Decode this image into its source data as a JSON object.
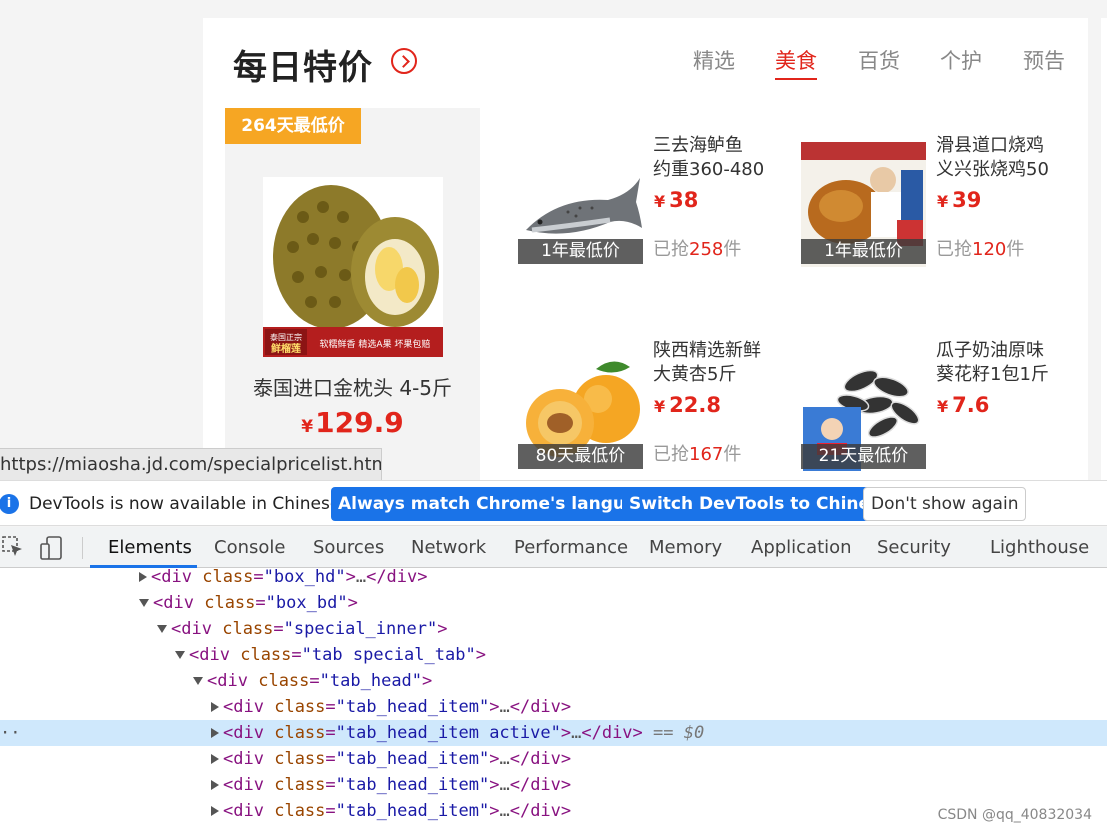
{
  "page": {
    "title": "每日特价",
    "tabs": [
      "精选",
      "美食",
      "百货",
      "个护",
      "预告"
    ],
    "active_tab": 1,
    "featured": {
      "tag": "264天最低价",
      "name": "泰国进口金枕头 4-5斤",
      "price_currency": "¥",
      "price": "129.9",
      "banner_text": [
        "泰国正宗",
        "鲜榴莲",
        "软糯鲜香",
        "精选A果",
        "坏果包赔"
      ]
    },
    "products": [
      {
        "name_line1": "三去海鲈鱼",
        "name_line2": "约重360-480",
        "currency": "¥",
        "price": "38",
        "badge": "1年最低价",
        "sold_prefix": "已抢",
        "sold_count": "258",
        "sold_suffix": "件"
      },
      {
        "name_line1": "滑县道口烧鸡",
        "name_line2": "义兴张烧鸡50",
        "currency": "¥",
        "price": "39",
        "badge": "1年最低价",
        "sold_prefix": "已抢",
        "sold_count": "120",
        "sold_suffix": "件"
      },
      {
        "name_line1": "陕西精选新鲜",
        "name_line2": "大黄杏5斤",
        "currency": "¥",
        "price": "22.8",
        "badge": "80天最低价",
        "sold_prefix": "已抢",
        "sold_count": "167",
        "sold_suffix": "件"
      },
      {
        "name_line1": "瓜子奶油原味",
        "name_line2": "葵花籽1包1斤",
        "currency": "¥",
        "price": "7.6",
        "badge": "21天最低价",
        "sold_prefix": "",
        "sold_count": "",
        "sold_suffix": ""
      }
    ]
  },
  "status_url": "https://miaosha.jd.com/specialpricelist.html",
  "devtools": {
    "infobar": {
      "message": "DevTools is now available in Chinese!",
      "btn_match": "Always match Chrome's language",
      "btn_switch": "Switch DevTools to Chinese",
      "btn_dismiss": "Don't show again"
    },
    "tabs": [
      "Elements",
      "Console",
      "Sources",
      "Network",
      "Performance",
      "Memory",
      "Application",
      "Security",
      "Lighthouse"
    ],
    "active_tab": "Elements",
    "dom_lines": [
      {
        "tag": "div",
        "attr": "class",
        "value": "box_hd",
        "collapsed": true,
        "close": true
      },
      {
        "tag": "div",
        "attr": "class",
        "value": "box_bd",
        "collapsed": false,
        "close": false
      },
      {
        "tag": "div",
        "attr": "class",
        "value": "special_inner",
        "collapsed": false,
        "close": false
      },
      {
        "tag": "div",
        "attr": "class",
        "value": "tab special_tab",
        "collapsed": false,
        "close": false
      },
      {
        "tag": "div",
        "attr": "class",
        "value": "tab_head",
        "collapsed": false,
        "close": false
      },
      {
        "tag": "div",
        "attr": "class",
        "value": "tab_head_item",
        "collapsed": true,
        "close": true
      },
      {
        "tag": "div",
        "attr": "class",
        "value": "tab_head_item active",
        "collapsed": true,
        "close": true,
        "selected": true,
        "suffix": "== $0"
      },
      {
        "tag": "div",
        "attr": "class",
        "value": "tab_head_item",
        "collapsed": true,
        "close": true
      },
      {
        "tag": "div",
        "attr": "class",
        "value": "tab_head_item",
        "collapsed": true,
        "close": true
      },
      {
        "tag": "div",
        "attr": "class",
        "value": "tab_head_item",
        "collapsed": true,
        "close": true
      }
    ]
  },
  "watermark": "CSDN @qq_40832034",
  "colors": {
    "accent": "#e1251b",
    "devtools_blue": "#1a73e8",
    "badge_orange": "#f6a623"
  }
}
